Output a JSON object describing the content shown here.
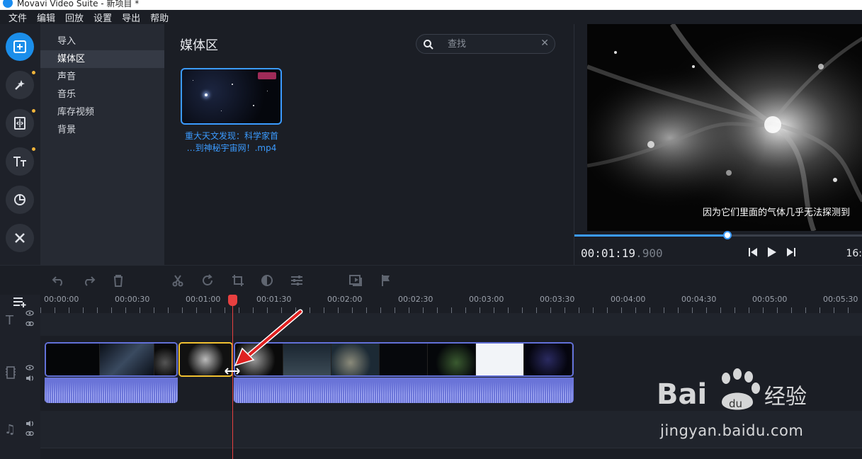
{
  "window": {
    "title": "Movavi Video Suite - 新项目 *"
  },
  "menu": [
    "文件",
    "编辑",
    "回放",
    "设置",
    "导出",
    "帮助"
  ],
  "categories": [
    {
      "label": "导入",
      "active": false
    },
    {
      "label": "媒体区",
      "active": true
    },
    {
      "label": "声音",
      "active": false
    },
    {
      "label": "音乐",
      "active": false
    },
    {
      "label": "库存视频",
      "active": false
    },
    {
      "label": "背景",
      "active": false
    }
  ],
  "media": {
    "title": "媒体区",
    "search_placeholder": "查找",
    "item_label_line1": "重大天文发现：科学家首",
    "item_label_line2": "…到神秘宇宙网！.mp4"
  },
  "preview": {
    "subtitle": "因为它们里面的气体几乎无法探测到",
    "timecode_main": "00:01:19",
    "timecode_ms": ".900",
    "end_time_partial": "16:",
    "progress": 0.53
  },
  "ruler_ticks": [
    "00:00:00",
    "00:00:30",
    "00:01:00",
    "00:01:30",
    "00:02:00",
    "00:02:30",
    "00:03:00",
    "00:03:30",
    "00:04:00",
    "00:04:30",
    "00:05:00",
    "00:05:30"
  ],
  "watermark": {
    "text": "jingyan.baidu.com",
    "logo": "Bai du 经验"
  },
  "colors": {
    "accent": "#3b9bff",
    "playhead": "#e84040",
    "clip_border": "#6270d8",
    "selected_clip": "#f0c030"
  }
}
